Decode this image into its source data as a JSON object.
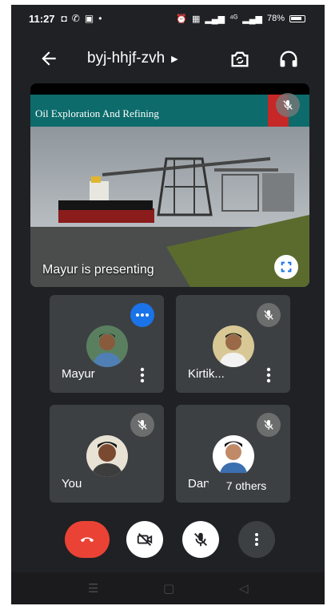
{
  "status_bar": {
    "time": "11:27",
    "network": "⁴ᴳ",
    "battery": "78%"
  },
  "header": {
    "meeting_code": "byj-hhjf-zvh"
  },
  "presentation": {
    "slide_title": "Oil Exploration And Refining",
    "label": "Mayur is presenting"
  },
  "participants": [
    {
      "name": "Mayur",
      "speaking": true
    },
    {
      "name": "Kirtik...",
      "muted": true
    },
    {
      "name": "You",
      "muted": true
    },
    {
      "name": "Dan",
      "muted": true
    }
  ],
  "others": "7 others",
  "colors": {
    "background": "#202124",
    "tile": "#3c4043",
    "end_call": "#ea4335",
    "speaking": "#1a73e8"
  }
}
